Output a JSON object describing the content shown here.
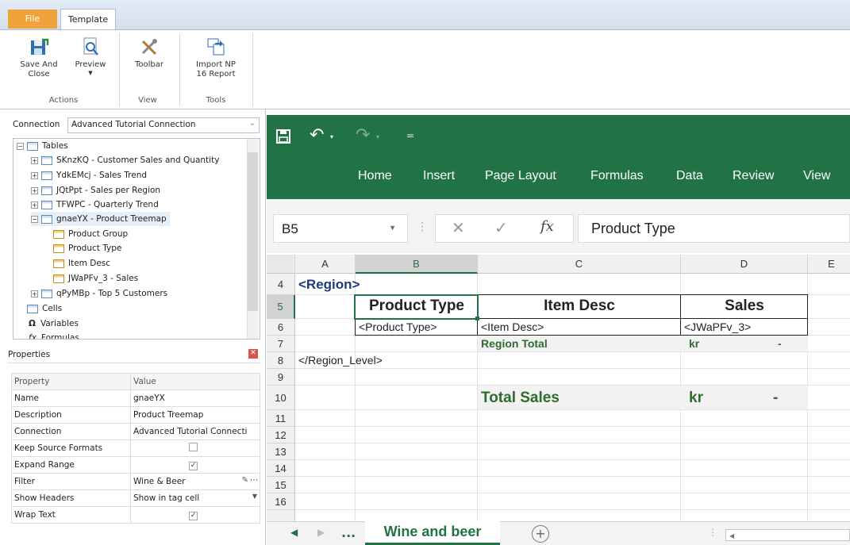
{
  "ribbon": {
    "file_tab": "File",
    "template_tab": "Template",
    "buttons": {
      "save_close": "Save And Close",
      "preview": "Preview",
      "toolbar": "Toolbar",
      "import": "Import NP 16 Report"
    },
    "groups": {
      "actions": "Actions",
      "view": "View",
      "tools": "Tools"
    }
  },
  "connection": {
    "label": "Connection",
    "value": "Advanced Tutorial Connection"
  },
  "tree": {
    "tables": "Tables",
    "items": [
      "SKnzKQ - Customer Sales and Quantity",
      "YdkEMcj - Sales Trend",
      "JQtPpt - Sales per Region",
      "TFWPC - Quarterly Trend",
      "gnaeYX - Product Treemap",
      "Product Group",
      "Product Type",
      "Item Desc",
      "JWaPFv_3 - Sales",
      "qPyMBp - Top 5 Customers",
      "Cells",
      "Variables",
      "Formulas"
    ]
  },
  "properties": {
    "title": "Properties",
    "header": {
      "property": "Property",
      "value": "Value"
    },
    "rows": [
      {
        "name": "Name",
        "value": "gnaeYX"
      },
      {
        "name": "Description",
        "value": "Product Treemap"
      },
      {
        "name": "Connection",
        "value": "Advanced Tutorial Connecti"
      },
      {
        "name": "Keep Source Formats",
        "value": ""
      },
      {
        "name": "Expand Range",
        "value": "✓"
      },
      {
        "name": "Filter",
        "value": "Wine & Beer"
      },
      {
        "name": "Show Headers",
        "value": "Show in tag cell"
      },
      {
        "name": "Wrap Text",
        "value": "✓"
      }
    ]
  },
  "excel": {
    "tabs": [
      "Home",
      "Insert",
      "Page Layout",
      "Formulas",
      "Data",
      "Review",
      "View"
    ],
    "name_box": "B5",
    "formula": "Product Type",
    "columns": [
      "A",
      "B",
      "C",
      "D",
      "E"
    ],
    "rows": [
      "4",
      "5",
      "6",
      "7",
      "8",
      "9",
      "10",
      "11",
      "12",
      "13",
      "14",
      "15",
      "16"
    ],
    "cells": {
      "a4": "<Region>",
      "b5": "Product Type",
      "c5": "Item Desc",
      "d5": "Sales",
      "b6": "<Product Type>",
      "c6": "<Item Desc>",
      "d6": "<JWaPFv_3>",
      "c7": "Region Total",
      "d7_cur": "kr",
      "d7_val": "-",
      "a8": "</Region_Level>",
      "c10": "Total Sales",
      "d10_cur": "kr",
      "d10_val": "-"
    },
    "sheet_tab": "Wine and beer",
    "ellipsis": "..."
  },
  "colors": {
    "excel_green": "#217346",
    "tag_blue": "#1f3a7a",
    "total_green": "#2e6b2e"
  }
}
